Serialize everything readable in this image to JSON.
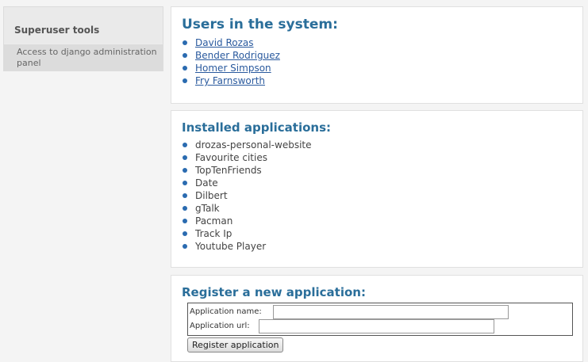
{
  "sidebar": {
    "title": "Superuser tools",
    "link": "Access to django administration panel"
  },
  "users": {
    "title": "Users in the system:",
    "items": [
      "David Rozas",
      "Bender Rodriguez",
      "Homer Simpson",
      "Fry Farnsworth"
    ]
  },
  "apps": {
    "title": "Installed applications:",
    "items": [
      "drozas-personal-website",
      "Favourite cities",
      "TopTenFriends",
      "Date",
      "Dilbert",
      "gTalk",
      "Pacman",
      "Track Ip",
      "Youtube Player"
    ]
  },
  "register": {
    "title": "Register a new application:",
    "name_label": "Application name:",
    "name_value": "",
    "url_label": "Application url:",
    "url_value": "",
    "submit_label": "Register application"
  },
  "colors": {
    "heading": "#2a6e9a",
    "link": "#2a5a9e",
    "bullet": "#2a6bb0"
  }
}
